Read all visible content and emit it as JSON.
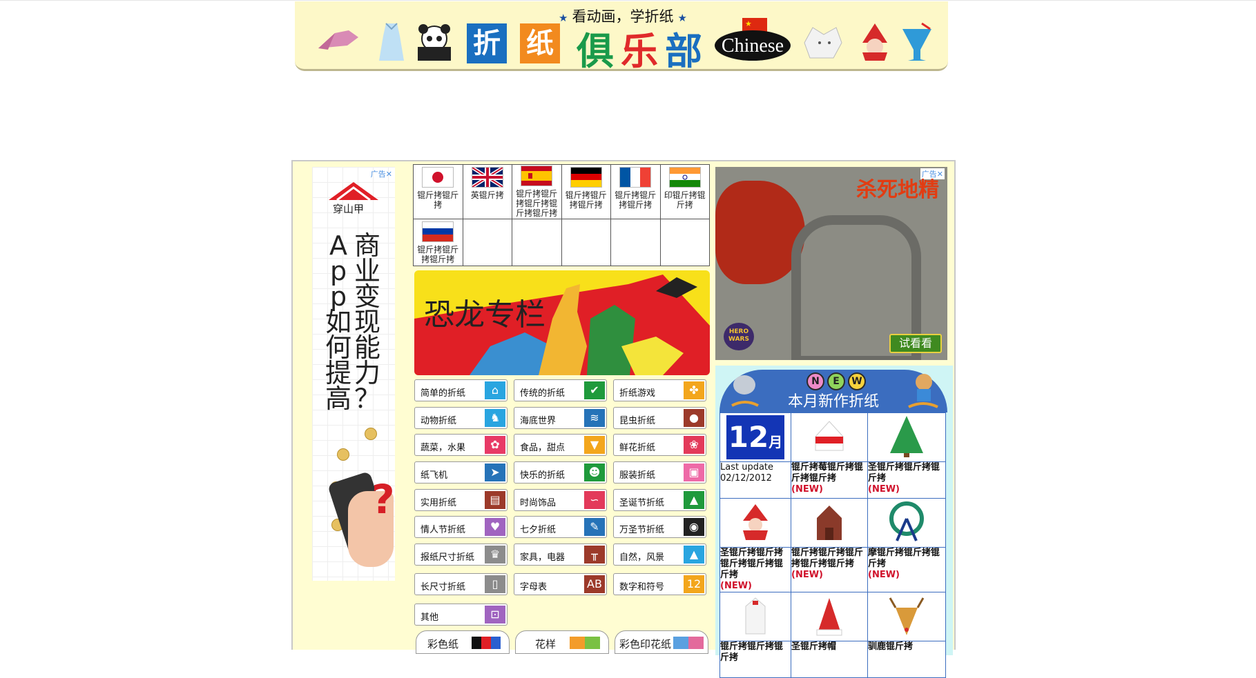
{
  "header": {
    "tagline": "看动画，学折纸",
    "title_chars": [
      "折",
      "纸",
      "俱",
      "乐",
      "部"
    ],
    "chinese_label": "Chinese"
  },
  "left_ad": {
    "badge": "广告✕",
    "brand": "穿山甲",
    "col1": [
      "A",
      "p",
      "p",
      "如",
      "何",
      "提",
      "高"
    ],
    "col2": [
      "商",
      "业",
      "变",
      "现",
      "能",
      "力",
      "？"
    ]
  },
  "languages": [
    {
      "label": "锟斤拷锟斤拷",
      "flag": "japan-flag"
    },
    {
      "label": "英锟斤拷",
      "flag": "uk-flag"
    },
    {
      "label": "锟斤拷锟斤拷锟斤拷锟斤拷锟斤拷",
      "flag": "spain-flag"
    },
    {
      "label": "锟斤拷锟斤拷锟斤拷",
      "flag": "germany-flag"
    },
    {
      "label": "锟斤拷锟斤拷锟斤拷",
      "flag": "france-flag"
    },
    {
      "label": "印锟斤拷锟斤拷",
      "flag": "india-flag"
    },
    {
      "label": "锟斤拷锟斤拷锟斤拷",
      "flag": "russia-flag"
    }
  ],
  "dino_banner": {
    "title": "恐龙专栏"
  },
  "categories": [
    {
      "label": "简单的折纸",
      "icon": "house-icon",
      "color": "#29a5e0"
    },
    {
      "label": "传统的折纸",
      "icon": "crane-icon",
      "color": "#1f9a3c"
    },
    {
      "label": "折纸游戏",
      "icon": "pinwheel-icon",
      "color": "#f3a61c"
    },
    {
      "label": "动物折纸",
      "icon": "giraffe-icon",
      "color": "#29a5e0"
    },
    {
      "label": "海底世界",
      "icon": "fish-icon",
      "color": "#2673b8"
    },
    {
      "label": "昆虫折纸",
      "icon": "ladybug-icon",
      "color": "#9c3a2a"
    },
    {
      "label": "蔬菜，水果",
      "icon": "strawberry-icon",
      "color": "#e83a66"
    },
    {
      "label": "食品，甜点",
      "icon": "icecream-icon",
      "color": "#f3a61c"
    },
    {
      "label": "鲜花折纸",
      "icon": "flower-icon",
      "color": "#e33a5a"
    },
    {
      "label": "纸飞机",
      "icon": "plane-icon",
      "color": "#2673b8"
    },
    {
      "label": "快乐的折纸",
      "icon": "ghost-icon",
      "color": "#1f9a3c"
    },
    {
      "label": "服装折纸",
      "icon": "shirt-icon",
      "color": "#ee6aa7"
    },
    {
      "label": "实用折纸",
      "icon": "wallet-icon",
      "color": "#9c3a2a"
    },
    {
      "label": "时尚饰品",
      "icon": "necklace-icon",
      "color": "#e33a5a"
    },
    {
      "label": "圣诞节折纸",
      "icon": "tree-icon",
      "color": "#1f9a3c"
    },
    {
      "label": "情人节折纸",
      "icon": "heart-icon",
      "color": "#a064c0"
    },
    {
      "label": "七夕折纸",
      "icon": "tanabata-icon",
      "color": "#2673b8"
    },
    {
      "label": "万圣节折纸",
      "icon": "pumpkin-icon",
      "color": "#222222"
    },
    {
      "label": "报纸尺寸折纸",
      "icon": "crown-icon",
      "color": "#8c8c8c"
    },
    {
      "label": "家具，电器",
      "icon": "table-icon",
      "color": "#9c3a2a"
    },
    {
      "label": "自然，风景",
      "icon": "mountain-icon",
      "color": "#29a5e0"
    },
    {
      "label": "长尺寸折纸",
      "icon": "rectangle-icon",
      "color": "#8c8c8c"
    },
    {
      "label": "字母表",
      "icon": "abc-icon",
      "color": "#9c3a2a"
    },
    {
      "label": "数字和符号",
      "icon": "numbers-icon",
      "color": "#f3a61c"
    },
    {
      "label": "其他",
      "icon": "car-icon",
      "color": "#a064c0"
    }
  ],
  "bottom_tabs": [
    {
      "label": "彩色纸"
    },
    {
      "label": "花样"
    },
    {
      "label": "彩色印花纸"
    }
  ],
  "right_ad": {
    "badge": "广告✕",
    "title": "杀死地精",
    "logo": "HERO WARS",
    "button": "试看看"
  },
  "new_works": {
    "badges": [
      "N",
      "E",
      "W"
    ],
    "title": "本月新作折纸",
    "date_box": {
      "day": "12",
      "unit": "月"
    },
    "last_update_label": "Last update",
    "last_update_date": "02/12/2012",
    "items": [
      {
        "caption": "锟斤拷莓锟斤拷锟斤拷锟斤拷",
        "new": "(NEW)",
        "icon": "strawberry-cake-icon"
      },
      {
        "caption": "圣锟斤拷锟斤拷锟斤拷",
        "new": "(NEW)",
        "icon": "christmas-tree-icon"
      },
      {
        "caption": "圣锟斤拷锟斤拷锟斤拷锟斤拷锟斤拷",
        "new": "(NEW)",
        "icon": "santa-icon"
      },
      {
        "caption": "锟斤拷锟斤拷锟斤拷锟斤拷锟斤拷",
        "new": "(NEW)",
        "icon": "house-icon"
      },
      {
        "caption": "摩锟斤拷锟斤拷锟斤拷",
        "new": "(NEW)",
        "icon": "ferris-wheel-icon"
      },
      {
        "caption": "锟斤拷锟斤拷锟斤拷",
        "new": "",
        "icon": "white-house-icon"
      },
      {
        "caption": "圣锟斤拷帽",
        "new": "",
        "icon": "santa-hat-icon"
      },
      {
        "caption": "驯鹿锟斤拷",
        "new": "",
        "icon": "reindeer-icon"
      }
    ]
  }
}
